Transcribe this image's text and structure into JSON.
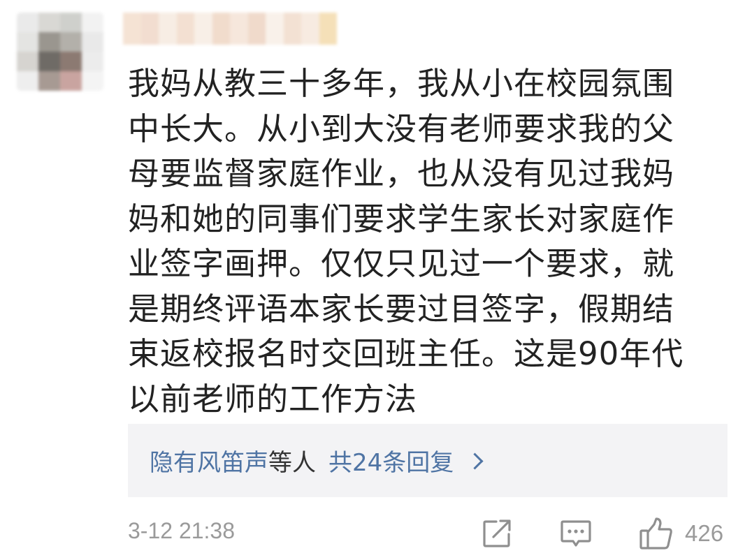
{
  "comment": {
    "lines": [
      "我妈从教三十多年，我从小在校园氛围",
      "中长大。从小到大没有老师要求我的父",
      "母要监督家庭作业，也从没有见过我妈",
      "妈和她的同事们要求学生家长对家庭作",
      "业签字画押。仅仅只见过一个要求，就",
      "是期终评语本家长要过目签字，假期结",
      "束返校报名时交回班主任。这是90年代",
      "以前老师的工作方法"
    ]
  },
  "replies": {
    "users": "隐有风笛声",
    "separator": "等人",
    "count_label": "共24条回复"
  },
  "footer": {
    "timestamp": "3-12 21:38",
    "like_count": "426"
  },
  "icons": {
    "share": "share-icon",
    "comment": "comment-icon",
    "like": "thumbs-up-icon",
    "reply_arrow": "chevron-right-icon"
  },
  "colors": {
    "link": "#4f74a4",
    "meta": "#9a9a9a",
    "reply_bg": "#f3f3f5"
  }
}
